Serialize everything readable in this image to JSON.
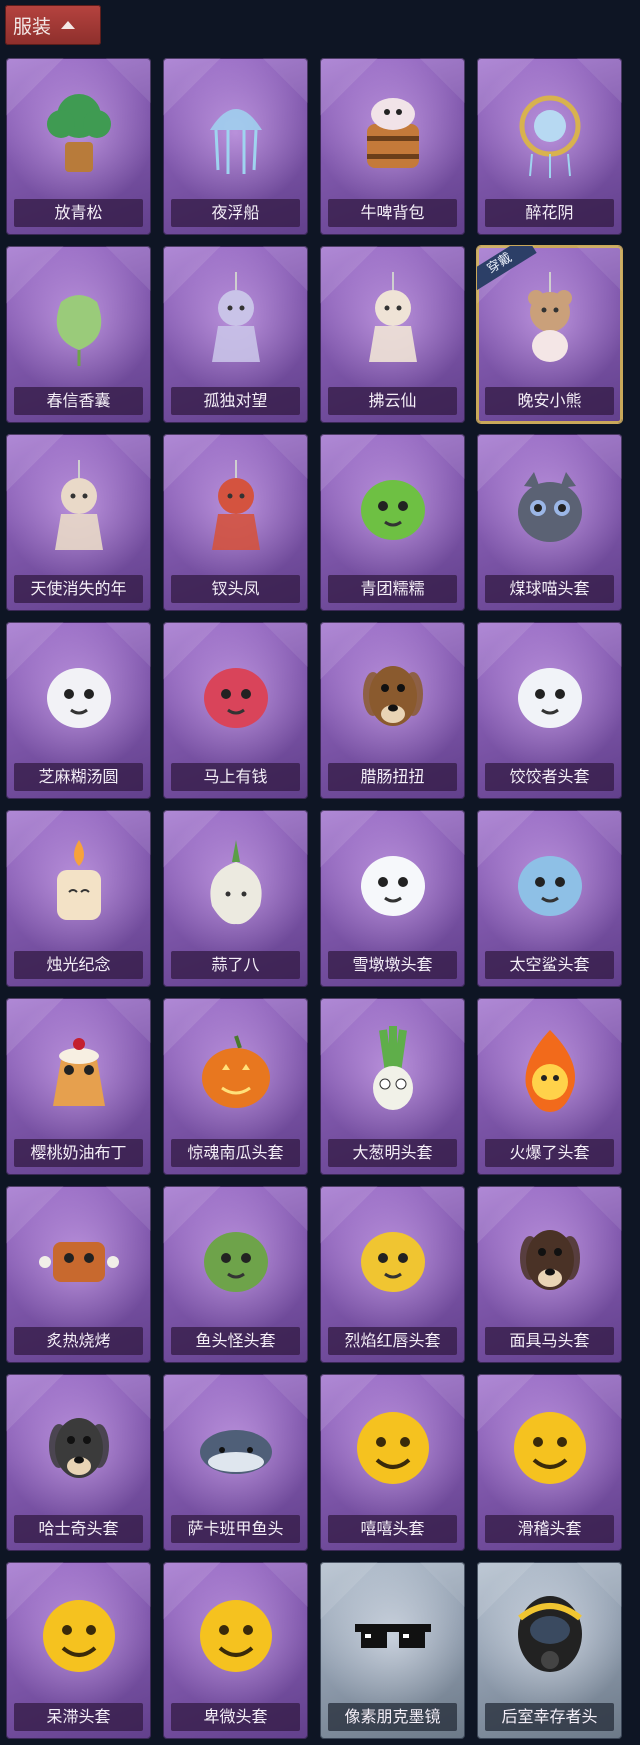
{
  "header": {
    "title": "服装"
  },
  "items": [
    {
      "name": "放青松",
      "icon": "bonsai-icon",
      "color": "#3f9b52",
      "shape": "tree"
    },
    {
      "name": "夜浮船",
      "icon": "jellyfish-icon",
      "color": "#9fd4f0",
      "shape": "jelly"
    },
    {
      "name": "牛啤背包",
      "icon": "beer-barrel-icon",
      "color": "#c47a3a",
      "shape": "barrel"
    },
    {
      "name": "醉花阴",
      "icon": "lantern-icon",
      "color": "#d8b24f",
      "shape": "lantern"
    },
    {
      "name": "春信香囊",
      "icon": "sachet-icon",
      "color": "#9acb7a",
      "shape": "sachet"
    },
    {
      "name": "孤独对望",
      "icon": "doll-charm-icon",
      "color": "#c9c3e8",
      "shape": "doll"
    },
    {
      "name": "拂云仙",
      "icon": "fairy-charm-icon",
      "color": "#efe3d6",
      "shape": "doll"
    },
    {
      "name": "晚安小熊",
      "icon": "bear-charm-icon",
      "color": "#caa07a",
      "shape": "bear",
      "equipped": true,
      "badge": "穿戴"
    },
    {
      "name": "天使消失的年",
      "icon": "angel-doll-icon",
      "color": "#e9d9c8",
      "shape": "doll"
    },
    {
      "name": "钗头凤",
      "icon": "phoenix-doll-icon",
      "color": "#d4533f",
      "shape": "doll"
    },
    {
      "name": "青团糯糯",
      "icon": "green-dumpling-icon",
      "color": "#6ec043",
      "shape": "blob"
    },
    {
      "name": "煤球喵头套",
      "icon": "cat-head-icon",
      "color": "#5b6274",
      "shape": "cat"
    },
    {
      "name": "芝麻糊汤圆",
      "icon": "dumpling-icon",
      "color": "#f2f2f6",
      "shape": "blob"
    },
    {
      "name": "马上有钱",
      "icon": "horse-head-icon",
      "color": "#d9445a",
      "shape": "blob"
    },
    {
      "name": "腊肠扭扭",
      "icon": "dog-head-icon",
      "color": "#8a5a2e",
      "shape": "dog"
    },
    {
      "name": "饺饺者头套",
      "icon": "cloud-head-icon",
      "color": "#f1f3f8",
      "shape": "blob"
    },
    {
      "name": "烛光纪念",
      "icon": "candle-icon",
      "color": "#f3e2c6",
      "shape": "candle"
    },
    {
      "name": "蒜了八",
      "icon": "garlic-icon",
      "color": "#eceae0",
      "shape": "garlic"
    },
    {
      "name": "雪墩墩头套",
      "icon": "snowman-head-icon",
      "color": "#f6f8fb",
      "shape": "blob"
    },
    {
      "name": "太空鲨头套",
      "icon": "shark-head-icon",
      "color": "#8ec0e6",
      "shape": "blob"
    },
    {
      "name": "樱桃奶油布丁",
      "icon": "pudding-icon",
      "color": "#e6a04e",
      "shape": "pudding"
    },
    {
      "name": "惊魂南瓜头套",
      "icon": "pumpkin-icon",
      "color": "#e8771f",
      "shape": "pumpkin"
    },
    {
      "name": "大葱明头套",
      "icon": "scallion-icon",
      "color": "#5fae4a",
      "shape": "scallion"
    },
    {
      "name": "火爆了头套",
      "icon": "fire-head-icon",
      "color": "#f26a1b",
      "shape": "fire"
    },
    {
      "name": "炙热烧烤",
      "icon": "meat-head-icon",
      "color": "#c8692e",
      "shape": "meat"
    },
    {
      "name": "鱼头怪头套",
      "icon": "fish-head-icon",
      "color": "#6ea34a",
      "shape": "blob"
    },
    {
      "name": "烈焰红唇头套",
      "icon": "yellow-mask-icon",
      "color": "#f0c531",
      "shape": "blob"
    },
    {
      "name": "面具马头套",
      "icon": "horse-mask-icon",
      "color": "#4a3226",
      "shape": "dog"
    },
    {
      "name": "哈士奇头套",
      "icon": "husky-head-icon",
      "color": "#3b3b3b",
      "shape": "dog"
    },
    {
      "name": "萨卡班甲鱼头",
      "icon": "fish-icon",
      "color": "#4f5f78",
      "shape": "fish"
    },
    {
      "name": "嘻嘻头套",
      "icon": "grin-emoji-icon",
      "color": "#f5c21f",
      "shape": "emoji"
    },
    {
      "name": "滑稽头套",
      "icon": "smirk-emoji-icon",
      "color": "#f5c21f",
      "shape": "emoji"
    },
    {
      "name": "呆滞头套",
      "icon": "stare-emoji-icon",
      "color": "#f5c21f",
      "shape": "emoji"
    },
    {
      "name": "卑微头套",
      "icon": "humble-emoji-icon",
      "color": "#f5c21f",
      "shape": "emoji"
    },
    {
      "name": "像素朋克墨镜",
      "icon": "pixel-sunglasses-icon",
      "color": "#111111",
      "shape": "glasses",
      "grey": true
    },
    {
      "name": "后室幸存者头",
      "icon": "gas-mask-icon",
      "color": "#222222",
      "shape": "gasmask",
      "grey": true
    }
  ]
}
